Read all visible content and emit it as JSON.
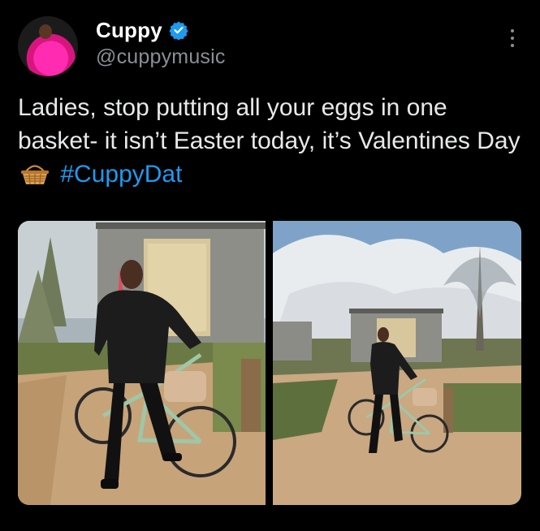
{
  "author": {
    "display_name": "Cuppy",
    "handle": "@cuppymusic",
    "verified": true,
    "avatar_icon": "avatar-pink-outfit"
  },
  "tweet": {
    "text_part1": "Ladies, stop putting all your eggs in one basket- it isn’t Easter today, it’s Valentines Day",
    "emoji_icon": "basket-icon",
    "hashtag": "#CuppyDat"
  },
  "media": {
    "count": 2,
    "photos": [
      {
        "icon": "photo-woman-bicycle-closeup"
      },
      {
        "icon": "photo-woman-bicycle-wide"
      }
    ]
  },
  "colors": {
    "background": "#000000",
    "text": "#e7e9ea",
    "secondary_text": "#8b8f95",
    "accent": "#1d9bf0"
  }
}
